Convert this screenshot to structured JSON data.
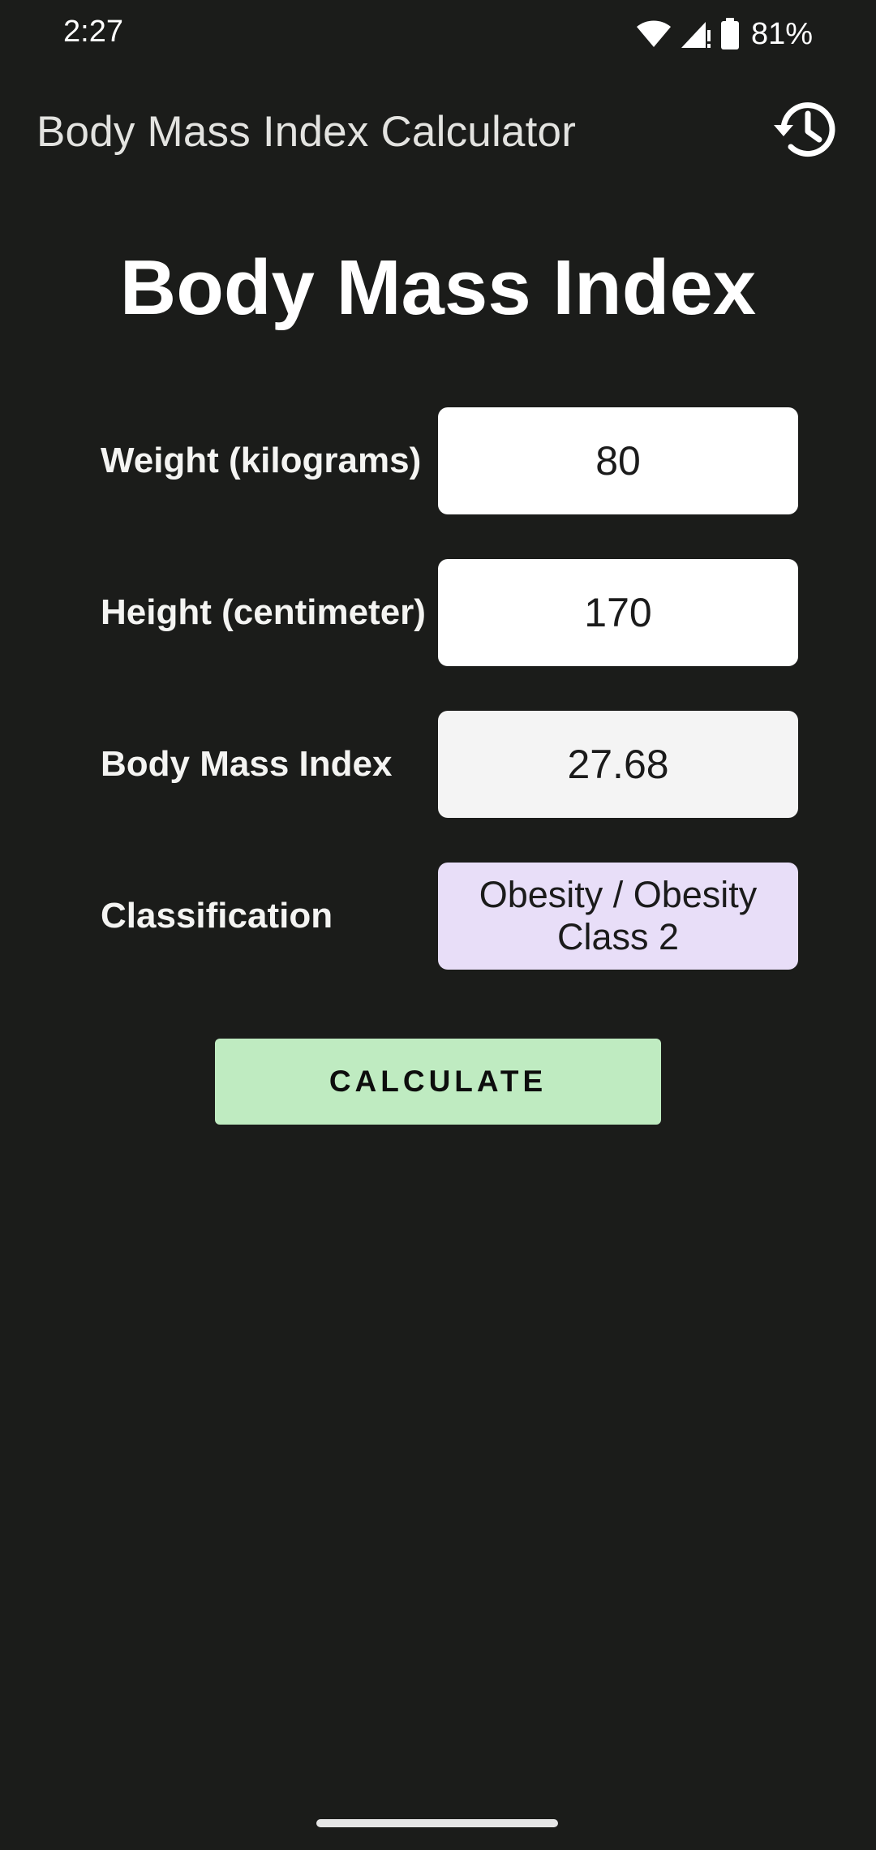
{
  "status_bar": {
    "time": "2:27",
    "battery_percent": "81%",
    "icons": [
      "wifi-icon",
      "cellular-signal-icon",
      "battery-icon"
    ]
  },
  "app_bar": {
    "title": "Body Mass Index Calculator",
    "history_icon": "history-icon"
  },
  "main": {
    "heading": "Body Mass Index",
    "fields": {
      "weight": {
        "label": "Weight (kilograms)",
        "value": "80"
      },
      "height": {
        "label": "Height (centimeter)",
        "value": "170"
      },
      "bmi": {
        "label": "Body Mass Index",
        "value": "27.68"
      },
      "classification": {
        "label": "Classification",
        "value": "Obesity / Obesity Class 2"
      }
    },
    "calculate_label": "CALCULATE"
  },
  "colors": {
    "background": "#1b1c1a",
    "input_background": "#ffffff",
    "result_background": "#f4f4f4",
    "classification_background": "#e8def8",
    "button_background": "#bfebc1"
  }
}
